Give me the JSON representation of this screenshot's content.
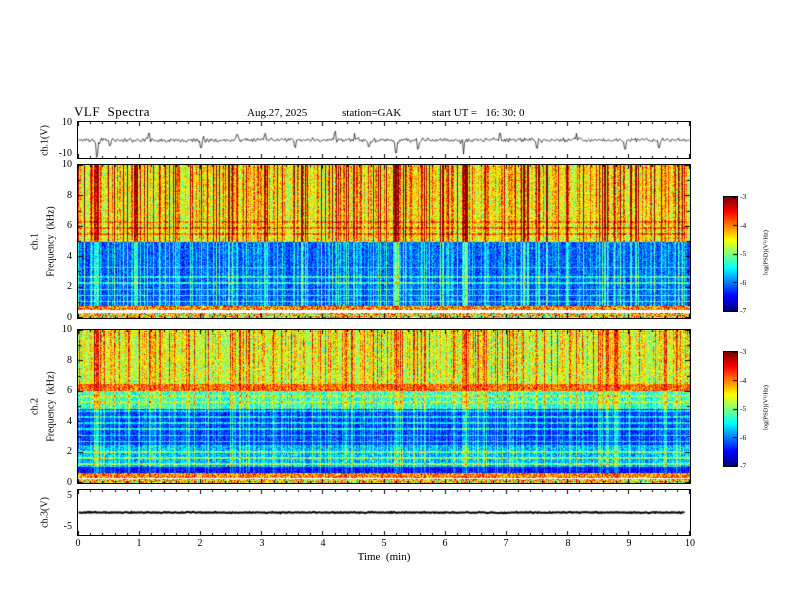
{
  "title": "VLF  Spectra",
  "header": {
    "date": "Aug.27, 2025",
    "station": "station=GAK",
    "start_ut": "start UT =   16: 30: 0"
  },
  "xaxis": {
    "label": "Time  (min)",
    "tick_labels": [
      "0",
      "1",
      "2",
      "3",
      "4",
      "5",
      "6",
      "7",
      "8",
      "9",
      "10"
    ]
  },
  "colorbar": {
    "label": "log(PSD)(V²/Hz)",
    "tick_labels": [
      "-3",
      "-4",
      "-5",
      "-6",
      "-7"
    ]
  },
  "panels": {
    "wave1": {
      "ylabel": "ch.1(V)",
      "ytick_top": "10",
      "ytick_bottom": "-10"
    },
    "spec1": {
      "channel": "ch.1",
      "ylabel": "Frequency  (kHz)",
      "yticks": [
        "10",
        "8",
        "6",
        "4",
        "2",
        "0"
      ]
    },
    "spec2": {
      "channel": "ch.2",
      "ylabel": "Frequency  (kHz)",
      "yticks": [
        "10",
        "8",
        "6",
        "4",
        "2",
        "0"
      ]
    },
    "wave3": {
      "ylabel": "ch.3(V)",
      "ytick_top": "5",
      "ytick_bottom": "-5"
    }
  },
  "chart_data": [
    {
      "type": "line",
      "name": "ch.1 broadband waveform",
      "ylabel": "ch.1(V)",
      "xlim": [
        0,
        10
      ],
      "ylim": [
        -10,
        10
      ],
      "noise_v": 1.1,
      "spikes": [
        {
          "t": 0.3,
          "v": -10
        },
        {
          "t": 1.15,
          "v": 4.5
        },
        {
          "t": 2.0,
          "v": -5
        },
        {
          "t": 2.6,
          "v": 3.5
        },
        {
          "t": 3.05,
          "v": 4
        },
        {
          "t": 3.55,
          "v": -4.5
        },
        {
          "t": 4.2,
          "v": 5
        },
        {
          "t": 4.75,
          "v": -4
        },
        {
          "t": 5.2,
          "v": -9
        },
        {
          "t": 5.55,
          "v": -5.5
        },
        {
          "t": 6.3,
          "v": -8
        },
        {
          "t": 6.9,
          "v": 4
        },
        {
          "t": 7.5,
          "v": -5
        },
        {
          "t": 8.15,
          "v": 4.5
        },
        {
          "t": 8.95,
          "v": -6
        },
        {
          "t": 9.5,
          "v": -4.5
        }
      ]
    },
    {
      "type": "heatmap",
      "name": "ch.1 VLF spectrogram",
      "channel": "ch.1",
      "ylabel": "Frequency (kHz)",
      "xlabel": "Time (min)",
      "xlim": [
        0,
        10
      ],
      "ylim": [
        0,
        10
      ],
      "clim": [
        -7,
        -3
      ],
      "colormap": "jet",
      "regions": [
        {
          "f0": 0.0,
          "f1": 0.32,
          "base": -5.6,
          "noise": 2.2,
          "sferic": 0.3
        },
        {
          "f0": 0.5,
          "f1": 0.78,
          "base": -4.9,
          "noise": 1.5,
          "sferic": 0.3
        },
        {
          "f0": 0.78,
          "f1": 5.0,
          "base": -6.75,
          "noise": 0.75,
          "sferic": 1.05
        },
        {
          "f0": 5.0,
          "f1": 10.01,
          "base": -5.45,
          "noise": 1.05,
          "sferic": 1.5,
          "ramp": 0.1
        }
      ],
      "gaps": [
        [
          0.32,
          0.5
        ]
      ],
      "hlines": [
        {
          "f": 1.05,
          "boost": 1.2
        },
        {
          "f": 1.45,
          "boost": 1.2
        },
        {
          "f": 1.85,
          "boost": 1.1
        },
        {
          "f": 2.25,
          "boost": 1.0
        },
        {
          "f": 2.65,
          "boost": 0.9
        },
        {
          "f": 3.3,
          "boost": 0.7
        },
        {
          "f": 5.5,
          "boost": 0.8
        },
        {
          "f": 5.9,
          "boost": 0.8
        },
        {
          "f": 6.3,
          "boost": 0.7
        }
      ],
      "event_times_min": [
        0.3,
        5.2,
        6.3
      ]
    },
    {
      "type": "heatmap",
      "name": "ch.2 VLF spectrogram",
      "channel": "ch.2",
      "ylabel": "Frequency (kHz)",
      "xlabel": "Time (min)",
      "xlim": [
        0,
        10
      ],
      "ylim": [
        0,
        10
      ],
      "clim": [
        -7,
        -3
      ],
      "colormap": "jet",
      "regions": [
        {
          "f0": 0.0,
          "f1": 0.2,
          "base": -5.5,
          "noise": 2.0,
          "sferic": 0.3
        },
        {
          "f0": 0.32,
          "f1": 0.62,
          "base": -4.8,
          "noise": 1.3,
          "sferic": 0.3
        },
        {
          "f0": 0.62,
          "f1": 1.05,
          "base": -6.9,
          "noise": 0.55,
          "sferic": 0.6
        },
        {
          "f0": 1.05,
          "f1": 2.45,
          "base": -6.45,
          "noise": 0.85,
          "sferic": 0.85
        },
        {
          "f0": 2.45,
          "f1": 4.85,
          "base": -6.8,
          "noise": 0.65,
          "sferic": 0.8
        },
        {
          "f0": 4.85,
          "f1": 6.0,
          "base": -6.05,
          "noise": 0.9,
          "sferic": 1.0
        },
        {
          "f0": 6.0,
          "f1": 6.5,
          "base": -4.6,
          "noise": 1.0,
          "sferic": 0.5
        },
        {
          "f0": 6.5,
          "f1": 10.01,
          "base": -5.55,
          "noise": 1.1,
          "sferic": 1.1,
          "ramp": 0.07
        }
      ],
      "gaps": [
        [
          0.2,
          0.32
        ]
      ],
      "hlines": [
        {
          "f": 1.2,
          "boost": 1.0
        },
        {
          "f": 1.6,
          "boost": 1.0
        },
        {
          "f": 2.0,
          "boost": 0.9
        },
        {
          "f": 2.7,
          "boost": 1.1
        },
        {
          "f": 3.1,
          "boost": 1.0
        },
        {
          "f": 3.5,
          "boost": 1.0
        },
        {
          "f": 3.9,
          "boost": 0.9
        },
        {
          "f": 4.3,
          "boost": 0.9
        },
        {
          "f": 4.7,
          "boost": 0.8
        },
        {
          "f": 5.3,
          "boost": 0.7
        },
        {
          "f": 5.7,
          "boost": 0.7
        }
      ],
      "event_times_min": [
        0.3,
        5.2,
        6.3
      ]
    },
    {
      "type": "line",
      "name": "ch.3 waveform (flat at 0 V)",
      "ylabel": "ch.3(V)",
      "xlim": [
        0,
        10
      ],
      "ylim": [
        -5,
        5
      ],
      "noise_v": 0.12,
      "spikes": [],
      "flat": true
    }
  ]
}
